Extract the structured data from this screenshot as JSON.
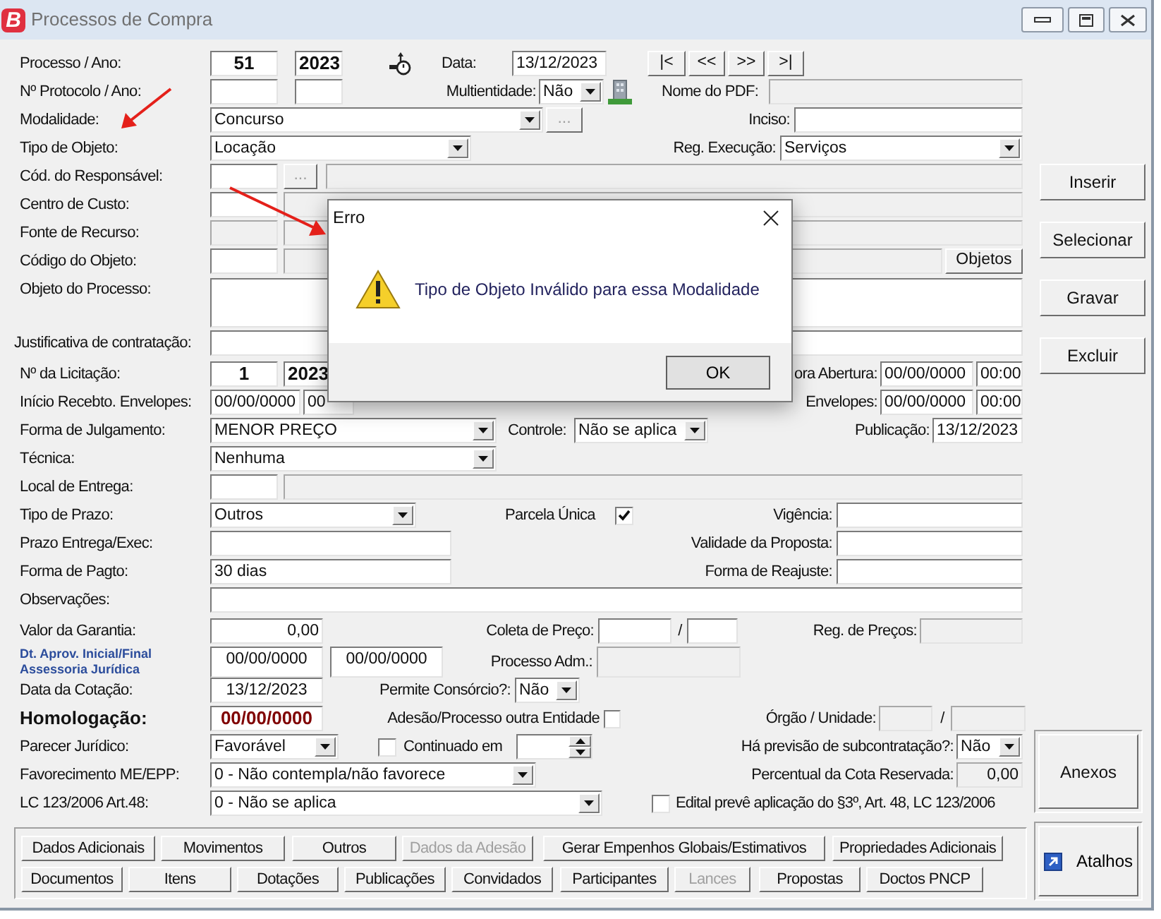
{
  "window": {
    "logo": "B",
    "title": "Processos de Compra"
  },
  "rows": [
    {
      "items": [
        {
          "kind": "label",
          "text": "Processo / Ano:"
        },
        {
          "kind": "input",
          "value": "51",
          "disabled": false
        },
        {
          "kind": "input",
          "value": "2023",
          "disabled": false
        },
        {
          "kind": "label",
          "text": "Data:"
        },
        {
          "kind": "input",
          "value": "13/12/2023",
          "disabled": false
        },
        {
          "kind": "button",
          "text": "|<",
          "disabled": false
        },
        {
          "kind": "button",
          "text": "<<",
          "disabled": false
        },
        {
          "kind": "button",
          "text": ">>",
          "disabled": false
        },
        {
          "kind": "button",
          "text": ">|",
          "disabled": false
        }
      ]
    },
    {
      "items": [
        {
          "kind": "label",
          "text": "Nº Protocolo / Ano:"
        },
        {
          "kind": "input",
          "disabled": false
        },
        {
          "kind": "input",
          "disabled": false
        },
        {
          "kind": "label",
          "text": "Multientidade:"
        },
        {
          "kind": "combo",
          "value": "Não"
        },
        {
          "kind": "label",
          "text": "Nome do PDF:"
        },
        {
          "kind": "input",
          "disabled": true
        }
      ]
    },
    {
      "items": [
        {
          "kind": "label",
          "text": "Modalidade:"
        },
        {
          "kind": "combo",
          "value": "Concurso"
        },
        {
          "kind": "button",
          "text": "...",
          "disabled": true
        },
        {
          "kind": "label",
          "text": "Inciso:"
        },
        {
          "kind": "input",
          "disabled": false
        }
      ]
    },
    {
      "items": [
        {
          "kind": "label",
          "text": "Tipo de Objeto:"
        },
        {
          "kind": "combo",
          "value": "Locação"
        },
        {
          "kind": "label",
          "text": "Reg. Execução:"
        },
        {
          "kind": "combo",
          "value": "Serviços"
        }
      ]
    },
    {
      "items": [
        {
          "kind": "label",
          "text": "Cód. do Responsável:"
        },
        {
          "kind": "input",
          "disabled": false
        },
        {
          "kind": "button",
          "text": "...",
          "disabled": true
        },
        {
          "kind": "input",
          "disabled": true
        }
      ]
    },
    {
      "items": [
        {
          "kind": "label",
          "text": "Centro de Custo:"
        },
        {
          "kind": "input",
          "disabled": false
        },
        {
          "kind": "input",
          "disabled": true
        }
      ]
    },
    {
      "items": [
        {
          "kind": "label",
          "text": "Fonte de Recurso:"
        },
        {
          "kind": "input",
          "disabled": true
        },
        {
          "kind": "input",
          "disabled": true
        }
      ]
    },
    {
      "items": [
        {
          "kind": "label",
          "text": "Código do Objeto:"
        },
        {
          "kind": "input",
          "disabled": false
        },
        {
          "kind": "input",
          "disabled": true
        },
        {
          "kind": "button",
          "text": "Objetos",
          "disabled": false
        }
      ]
    },
    {
      "items": [
        {
          "kind": "label",
          "text": "Objeto do Processo:"
        },
        {
          "kind": "textarea",
          "disabled": false
        }
      ]
    },
    {
      "items": [
        {
          "kind": "label",
          "text": "Justificativa de contratação:"
        },
        {
          "kind": "input",
          "disabled": false
        }
      ]
    },
    {
      "items": [
        {
          "kind": "label",
          "text": "Nº da Licitação:"
        },
        {
          "kind": "input",
          "value": "1",
          "disabled": false
        },
        {
          "kind": "input",
          "value": "2023",
          "disabled": false
        },
        {
          "kind": "label",
          "text": "ora Abertura:"
        },
        {
          "kind": "input",
          "value": "00/00/0000",
          "disabled": false
        },
        {
          "kind": "input",
          "value": "00:00",
          "disabled": false
        }
      ]
    },
    {
      "items": [
        {
          "kind": "label",
          "text": "Início Recebto. Envelopes:"
        },
        {
          "kind": "input",
          "value": "00/00/0000",
          "disabled": false
        },
        {
          "kind": "input",
          "value": "00",
          "disabled": false
        },
        {
          "kind": "label",
          "text": "Envelopes:"
        },
        {
          "kind": "input",
          "value": "00/00/0000",
          "disabled": false
        },
        {
          "kind": "input",
          "value": "00:00",
          "disabled": false
        }
      ]
    },
    {
      "items": [
        {
          "kind": "label",
          "text": "Forma de Julgamento:"
        },
        {
          "kind": "combo",
          "value": "MENOR PREÇO"
        },
        {
          "kind": "label",
          "text": "Controle:"
        },
        {
          "kind": "combo",
          "value": "Não se aplica"
        },
        {
          "kind": "label",
          "text": "Publicação:"
        },
        {
          "kind": "input",
          "value": "13/12/2023",
          "disabled": false
        }
      ]
    },
    {
      "items": [
        {
          "kind": "label",
          "text": "Técnica:"
        },
        {
          "kind": "combo",
          "value": "Nenhuma"
        }
      ]
    },
    {
      "items": [
        {
          "kind": "label",
          "text": "Local de Entrega:"
        },
        {
          "kind": "input",
          "disabled": false
        },
        {
          "kind": "input",
          "disabled": true
        }
      ]
    },
    {
      "items": [
        {
          "kind": "label",
          "text": "Tipo de Prazo:"
        },
        {
          "kind": "combo",
          "value": "Outros"
        },
        {
          "kind": "label",
          "text": "Parcela Única"
        },
        {
          "kind": "checkbox",
          "checked": true
        },
        {
          "kind": "label",
          "text": "Vigência:"
        },
        {
          "kind": "input",
          "disabled": false
        }
      ]
    },
    {
      "items": [
        {
          "kind": "label",
          "text": "Prazo Entrega/Exec:"
        },
        {
          "kind": "input",
          "disabled": false
        },
        {
          "kind": "label",
          "text": "Validade da Proposta:"
        },
        {
          "kind": "input",
          "disabled": false
        }
      ]
    },
    {
      "items": [
        {
          "kind": "label",
          "text": "Forma de Pagto:"
        },
        {
          "kind": "input",
          "value": "30 dias",
          "disabled": false
        },
        {
          "kind": "label",
          "text": "Forma de Reajuste:"
        },
        {
          "kind": "input",
          "disabled": false
        }
      ]
    },
    {
      "items": [
        {
          "kind": "label",
          "text": "Observações:"
        },
        {
          "kind": "input",
          "disabled": false
        }
      ]
    },
    {
      "items": [
        {
          "kind": "label",
          "text": "Valor da Garantia:"
        },
        {
          "kind": "input",
          "value": "0,00",
          "disabled": false
        },
        {
          "kind": "label",
          "text": "Coleta de Preço:"
        },
        {
          "kind": "input",
          "disabled": false
        },
        {
          "kind": "label",
          "text": "/"
        },
        {
          "kind": "input",
          "disabled": false
        },
        {
          "kind": "label",
          "text": "Reg. de Preços:"
        },
        {
          "kind": "input",
          "disabled": true
        }
      ]
    },
    {
      "items": [
        {
          "kind": "caption",
          "lines": [
            "Dt. Aprov. Inicial/Final",
            "Assessoria Jurídica"
          ]
        },
        {
          "kind": "input",
          "value": "00/00/0000",
          "disabled": false
        },
        {
          "kind": "input",
          "value": "00/00/0000",
          "disabled": false
        },
        {
          "kind": "label",
          "text": "Processo Adm.:"
        },
        {
          "kind": "input",
          "disabled": true
        }
      ]
    },
    {
      "items": [
        {
          "kind": "label",
          "text": "Data da Cotação:"
        },
        {
          "kind": "input",
          "value": "13/12/2023",
          "disabled": false
        },
        {
          "kind": "label",
          "text": "Permite Consórcio?:"
        },
        {
          "kind": "combo",
          "value": "Não"
        }
      ]
    },
    {
      "items": [
        {
          "kind": "label",
          "text": "Homologação:"
        },
        {
          "kind": "input",
          "value": "00/00/0000",
          "disabled": false
        },
        {
          "kind": "label",
          "text": "Adesão/Processo outra Entidade"
        },
        {
          "kind": "checkbox",
          "checked": false
        },
        {
          "kind": "label",
          "text": "Órgão / Unidade:"
        },
        {
          "kind": "input",
          "disabled": true
        },
        {
          "kind": "label",
          "text": "/"
        },
        {
          "kind": "input",
          "disabled": true
        }
      ]
    },
    {
      "items": [
        {
          "kind": "label",
          "text": "Parecer Jurídico:"
        },
        {
          "kind": "combo",
          "value": "Favorável"
        },
        {
          "kind": "checkbox",
          "checked": false
        },
        {
          "kind": "label",
          "text": "Continuado em"
        },
        {
          "kind": "spin"
        },
        {
          "kind": "label",
          "text": "Há previsão de subcontratação?:"
        },
        {
          "kind": "combo",
          "value": "Não"
        }
      ]
    },
    {
      "items": [
        {
          "kind": "label",
          "text": "Favorecimento ME/EPP:"
        },
        {
          "kind": "combo",
          "value": "0 - Não contempla/não favorece"
        },
        {
          "kind": "label",
          "text": "Percentual da Cota Reservada:"
        },
        {
          "kind": "input",
          "value": "0,00",
          "disabled": true
        }
      ]
    },
    {
      "items": [
        {
          "kind": "label",
          "text": "LC 123/2006 Art.48:"
        },
        {
          "kind": "combo",
          "value": "0 - Não se aplica"
        },
        {
          "kind": "checkbox",
          "checked": false
        },
        {
          "kind": "label",
          "text": "Edital prevê aplicação do §3º, Art. 48, LC 123/2006"
        }
      ]
    }
  ],
  "side_buttons": [
    "Inserir",
    "Selecionar",
    "Gravar",
    "Excluir"
  ],
  "anexos_button": "Anexos",
  "bottom_buttons": [
    {
      "buttons": [
        {
          "label": "Dados Adicionais",
          "disabled": false
        },
        {
          "label": "Movimentos",
          "disabled": false
        },
        {
          "label": "Outros",
          "disabled": false
        },
        {
          "label": "Dados da Adesão",
          "disabled": true
        },
        {
          "label": "Gerar Empenhos Globais/Estimativos",
          "disabled": false
        },
        {
          "label": "Propriedades Adicionais",
          "disabled": false
        }
      ]
    },
    {
      "buttons": [
        {
          "label": "Documentos",
          "disabled": false
        },
        {
          "label": "Itens",
          "disabled": false
        },
        {
          "label": "Dotações",
          "disabled": false
        },
        {
          "label": "Publicações",
          "disabled": false
        },
        {
          "label": "Convidados",
          "disabled": false
        },
        {
          "label": "Participantes",
          "disabled": false
        },
        {
          "label": "Lances",
          "disabled": true
        },
        {
          "label": "Propostas",
          "disabled": false
        },
        {
          "label": "Doctos PNCP",
          "disabled": false
        }
      ]
    }
  ],
  "atalhos_button": "Atalhos",
  "dialog": {
    "title": "Erro",
    "message": "Tipo de Objeto Inválido para essa Modalidade",
    "button": "OK"
  }
}
